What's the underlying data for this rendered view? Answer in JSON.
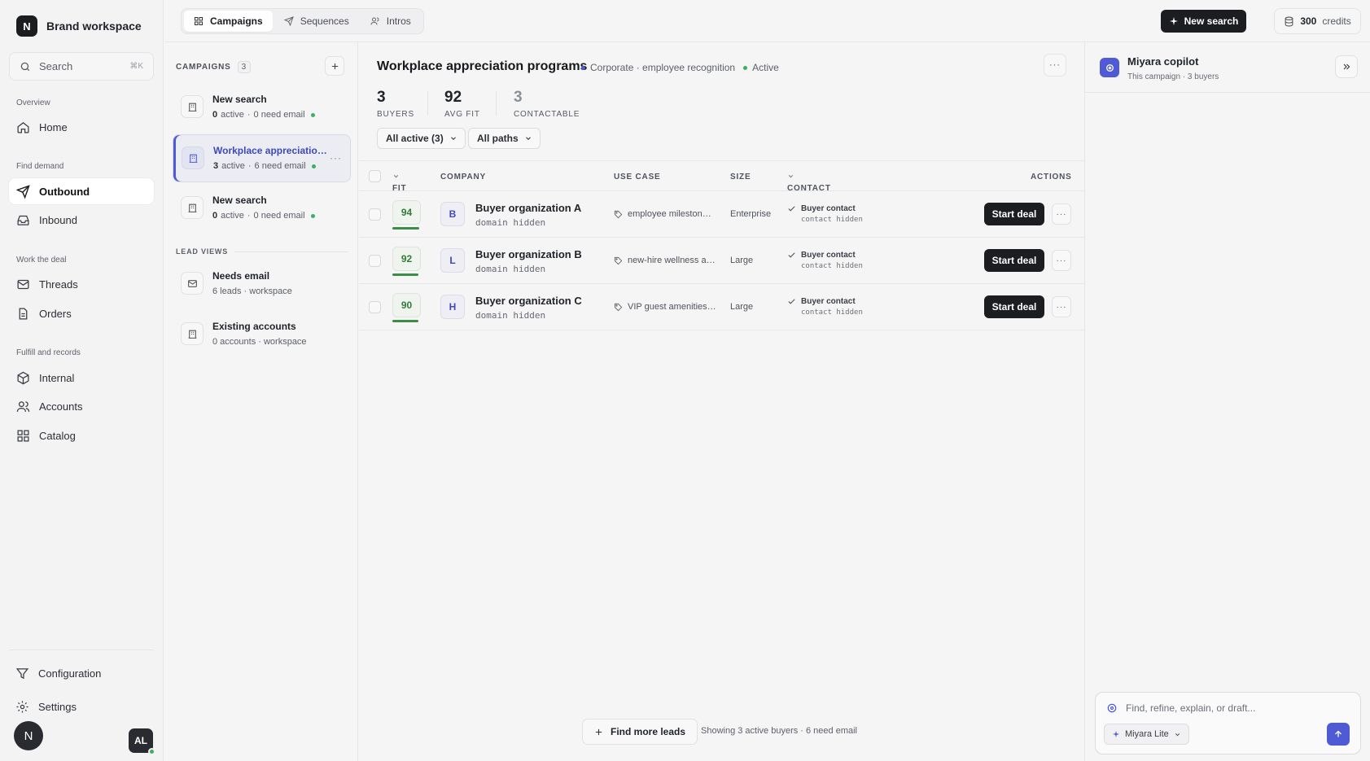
{
  "workspace": {
    "logo_letter": "N",
    "name": "Brand workspace"
  },
  "search": {
    "label": "Search",
    "shortcut": "⌘K"
  },
  "sidebar": {
    "sections": [
      {
        "label": "Overview"
      },
      {
        "label": "Find demand"
      },
      {
        "label": "Work the deal"
      },
      {
        "label": "Fulfill and records"
      }
    ],
    "items": [
      {
        "label": "Home",
        "icon": "home-icon"
      },
      {
        "label": "Outbound",
        "icon": "send-icon",
        "active": true
      },
      {
        "label": "Inbound",
        "icon": "inbox-icon"
      },
      {
        "label": "Threads",
        "icon": "mail-icon"
      },
      {
        "label": "Orders",
        "icon": "document-icon"
      },
      {
        "label": "Internal",
        "icon": "box-icon"
      },
      {
        "label": "Accounts",
        "icon": "users-icon"
      },
      {
        "label": "Catalog",
        "icon": "grid-icon"
      }
    ],
    "footer": [
      {
        "label": "Configuration",
        "icon": "filter-icon"
      },
      {
        "label": "Settings",
        "icon": "gear-icon"
      }
    ],
    "avatar_letter": "N",
    "user_initials": "AL"
  },
  "topnav": {
    "tabs": [
      {
        "label": "Campaigns",
        "icon": "grid-icon",
        "active": true
      },
      {
        "label": "Sequences",
        "icon": "send-icon"
      },
      {
        "label": "Intros",
        "icon": "users-icon"
      }
    ],
    "new_search_label": "New search",
    "credits_value": "300",
    "credits_label": "credits"
  },
  "campaigns_panel": {
    "header": "CAMPAIGNS",
    "count": "3",
    "items": [
      {
        "title": "New search",
        "active_count": "0",
        "active_label": "active",
        "email_note": "0 need email"
      },
      {
        "title": "Workplace appreciatio…",
        "active_count": "3",
        "active_label": "active",
        "email_note": "6 need email",
        "selected": true
      },
      {
        "title": "New search",
        "active_count": "0",
        "active_label": "active",
        "email_note": "0 need email"
      }
    ],
    "lead_views_header": "LEAD VIEWS",
    "lead_views": [
      {
        "title": "Needs email",
        "meta": "6 leads · workspace",
        "icon": "mail-icon"
      },
      {
        "title": "Existing accounts",
        "meta": "0 accounts · workspace",
        "icon": "building-icon"
      }
    ]
  },
  "main": {
    "title": "Workplace appreciation programs",
    "category": "Corporate · employee recognition",
    "status": "Active",
    "stats": [
      {
        "value": "3",
        "label": "BUYERS"
      },
      {
        "value": "92",
        "label": "AVG FIT"
      },
      {
        "value": "3",
        "label": "CONTACTABLE"
      }
    ],
    "filters": [
      {
        "label": "All active (3)"
      },
      {
        "label": "All paths"
      }
    ],
    "columns": {
      "fit": "FIT",
      "company": "COMPANY",
      "use_case": "USE CASE",
      "size": "SIZE",
      "contact": "CONTACT",
      "actions": "ACTIONS"
    },
    "rows": [
      {
        "fit": "94",
        "fit_fraction": 0.94,
        "letter": "B",
        "company": "Buyer organization A",
        "domain": "domain hidden",
        "use_case": "employee mileston…",
        "size": "Enterprise",
        "contact": "Buyer contact",
        "contact_sub": "contact hidden",
        "action": "Start deal"
      },
      {
        "fit": "92",
        "fit_fraction": 0.92,
        "letter": "L",
        "company": "Buyer organization B",
        "domain": "domain hidden",
        "use_case": "new-hire wellness a…",
        "size": "Large",
        "contact": "Buyer contact",
        "contact_sub": "contact hidden",
        "action": "Start deal"
      },
      {
        "fit": "90",
        "fit_fraction": 0.9,
        "letter": "H",
        "company": "Buyer organization C",
        "domain": "domain hidden",
        "use_case": "VIP guest amenities…",
        "size": "Large",
        "contact": "Buyer contact",
        "contact_sub": "contact hidden",
        "action": "Start deal"
      }
    ],
    "find_more_label": "Find more leads",
    "showing_text": "Showing 3 active buyers · 6 need email"
  },
  "copilot": {
    "title": "Miyara copilot",
    "subtitle": "This campaign · 3 buyers",
    "placeholder": "Find, refine, explain, or draft...",
    "model": "Miyara Lite"
  },
  "colors": {
    "accent": "#4f5bd5",
    "dark": "#1c1d21",
    "success": "#3eae5f",
    "fit_green": "#2f7d3a"
  }
}
